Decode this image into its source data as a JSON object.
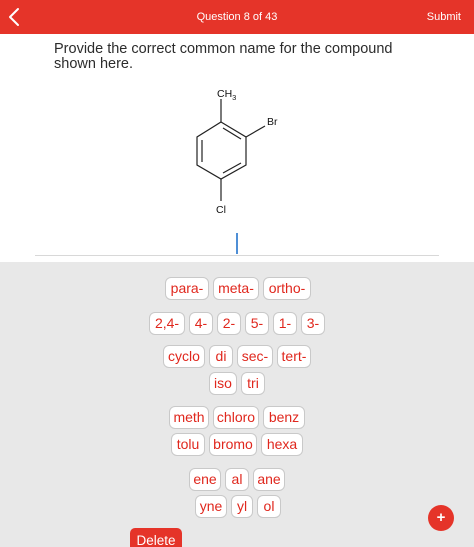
{
  "header": {
    "question_counter": "Question 8 of 43",
    "submit_label": "Submit",
    "back_icon": "chevron-left-icon"
  },
  "prompt": {
    "text": "Provide the correct common name for the compound shown here."
  },
  "structure": {
    "methyl_label": "CH",
    "methyl_subscript": "3",
    "bromo_label": "Br",
    "chloro_label": "Cl"
  },
  "answer": {
    "value": ""
  },
  "tiles": {
    "row1": [
      "para-",
      "meta-",
      "ortho-"
    ],
    "row2": [
      "2,4-",
      "4-",
      "2-",
      "5-",
      "1-",
      "3-"
    ],
    "row3": [
      "cyclo",
      "di",
      "sec-",
      "tert-"
    ],
    "row4": [
      "iso",
      "tri"
    ],
    "row5": [
      "meth",
      "chloro",
      "benz"
    ],
    "row6": [
      "tolu",
      "bromo",
      "hexa"
    ],
    "row7": [
      "ene",
      "al",
      "ane"
    ],
    "row8": [
      "yne",
      "yl",
      "ol"
    ]
  },
  "footer": {
    "delete_label": "Delete",
    "fab_label": "+"
  },
  "colors": {
    "accent": "#e53429",
    "tile_text": "#e0271d",
    "tray_background": "#e8e8e8",
    "caret": "#4f8fd6"
  }
}
